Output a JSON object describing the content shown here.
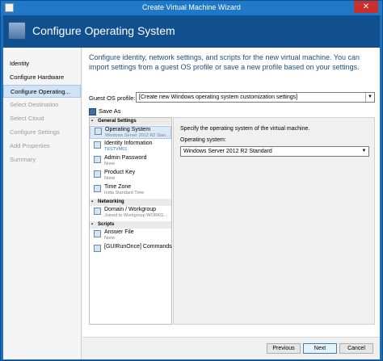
{
  "window": {
    "title": "Create Virtual Machine Wizard",
    "close_glyph": "✕"
  },
  "header": {
    "title": "Configure Operating System",
    "icon": "wizard-icon"
  },
  "nav": {
    "items": [
      {
        "label": "Identity",
        "state": "normal"
      },
      {
        "label": "Configure Hardware",
        "state": "normal"
      },
      {
        "label": "Configure Operating...",
        "state": "selected"
      },
      {
        "label": "Select Destination",
        "state": "disabled"
      },
      {
        "label": "Select Cloud",
        "state": "disabled"
      },
      {
        "label": "Configure Settings",
        "state": "disabled"
      },
      {
        "label": "Add Properties",
        "state": "disabled"
      },
      {
        "label": "Summary",
        "state": "disabled"
      }
    ]
  },
  "main": {
    "description": "Configure identity, network settings, and scripts for the new virtual machine. You can import settings from a guest OS profile or save a new profile based on your settings.",
    "guest_profile_label": "Guest OS profile:",
    "guest_profile_value": "[Create new Windows operating system customization settings]",
    "save_as_label": "Save As"
  },
  "tree": {
    "sections": {
      "general": "General Settings",
      "networking": "Networking",
      "scripts": "Scripts"
    },
    "items": {
      "os": {
        "name": "Operating System",
        "sub": "Windows Server 2012 R2 Stan..."
      },
      "identity": {
        "name": "Identity Information",
        "sub": "TESTVM01"
      },
      "admin": {
        "name": "Admin Password",
        "sub": "None"
      },
      "product_key": {
        "name": "Product Key",
        "sub": "None"
      },
      "time_zone": {
        "name": "Time Zone",
        "sub": "India Standard Time"
      },
      "domain": {
        "name": "Domain / Workgroup",
        "sub": "Joined to Workgroup WORKG..."
      },
      "answer_file": {
        "name": "Answer File",
        "sub": "None"
      },
      "gui_run_once": {
        "name": "[GUIRunOnce] Commands",
        "sub": ""
      }
    }
  },
  "detail": {
    "intro": "Specify the operating system of the virtual machine.",
    "os_label": "Operating system:",
    "os_value": "Windows Server 2012 R2 Standard"
  },
  "footer": {
    "previous": "Previous",
    "next": "Next",
    "cancel": "Cancel"
  },
  "colors": {
    "header_bg": "#11508e",
    "title_bar": "#1f78c8",
    "accent_text": "#1f4e79",
    "selected_bg": "#cfe3f6"
  }
}
